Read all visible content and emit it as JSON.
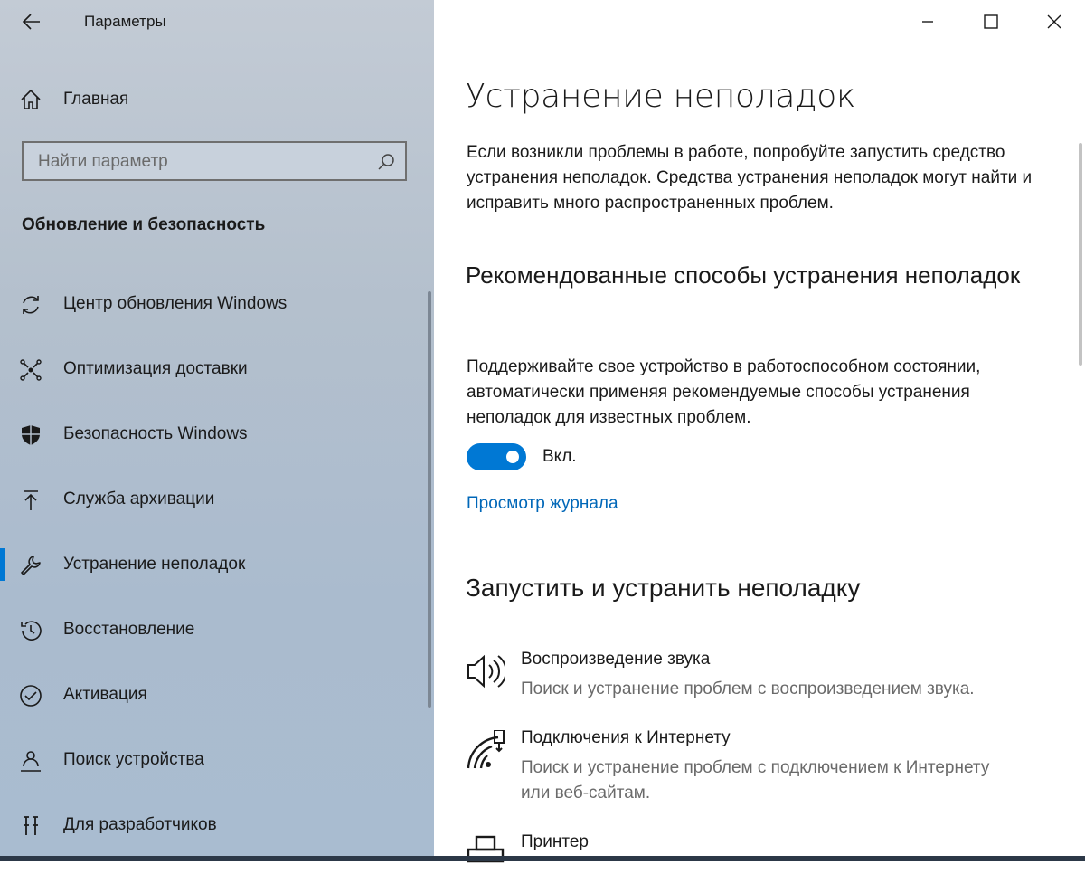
{
  "window": {
    "title": "Параметры",
    "controls": [
      "minimize-icon",
      "maximize-icon",
      "close-icon"
    ]
  },
  "sidebar": {
    "home_label": "Главная",
    "search_placeholder": "Найти параметр",
    "section_title": "Обновление и безопасность",
    "items": [
      {
        "label": "Центр обновления Windows",
        "icon": "sync-icon"
      },
      {
        "label": "Оптимизация доставки",
        "icon": "delivery-icon"
      },
      {
        "label": "Безопасность Windows",
        "icon": "shield-icon"
      },
      {
        "label": "Служба архивации",
        "icon": "backup-icon"
      },
      {
        "label": "Устранение неполадок",
        "icon": "wrench-icon",
        "selected": true
      },
      {
        "label": "Восстановление",
        "icon": "history-icon"
      },
      {
        "label": "Активация",
        "icon": "check-circle-icon"
      },
      {
        "label": "Поиск устройства",
        "icon": "person-pin-icon"
      },
      {
        "label": "Для разработчиков",
        "icon": "developer-icon"
      }
    ]
  },
  "main": {
    "title": "Устранение неполадок",
    "intro": "Если возникли проблемы в работе, попробуйте запустить средство устранения неполадок. Средства устранения неполадок могут найти и исправить много распространенных проблем.",
    "recommended_title": "Рекомендованные способы устранения неполадок",
    "recommended_desc": "Поддерживайте свое устройство в работоспособном состоянии, автоматически применяя рекомендуемые способы устранения неполадок для известных проблем.",
    "toggle_label": "Вкл.",
    "toggle_on": true,
    "history_link": "Просмотр журнала",
    "run_title": "Запустить и устранить неполадку",
    "troubleshooters": [
      {
        "title": "Воспроизведение звука",
        "desc": "Поиск и устранение проблем с воспроизведением звука.",
        "icon": "speaker-icon"
      },
      {
        "title": "Подключения к Интернету",
        "desc": "Поиск и устранение проблем с подключением к Интернету или веб-сайтам.",
        "icon": "network-icon"
      },
      {
        "title": "Принтер",
        "icon": "printer-icon"
      }
    ]
  },
  "colors": {
    "accent": "#0078d4",
    "link": "#0067b8"
  }
}
